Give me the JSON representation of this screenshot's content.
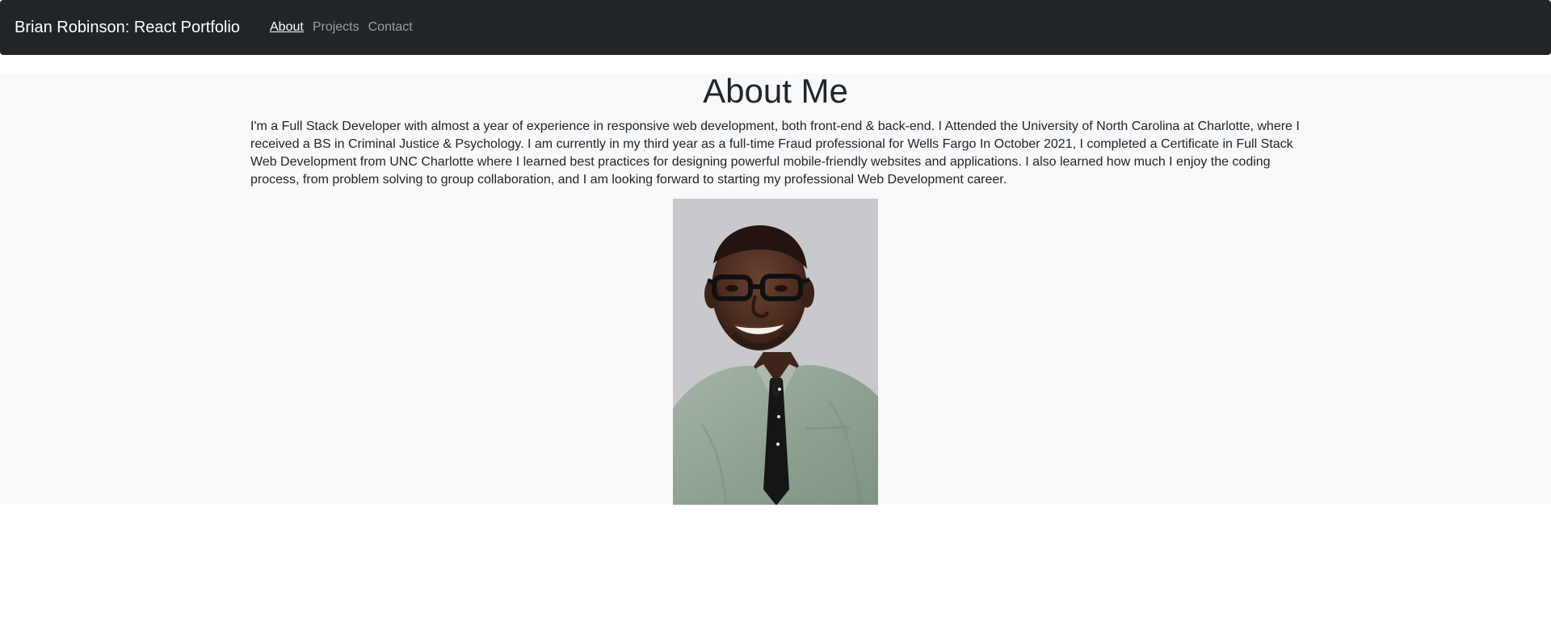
{
  "site": {
    "brand": "Brian Robinson: React Portfolio"
  },
  "nav": {
    "items": [
      {
        "label": "About",
        "active": true
      },
      {
        "label": "Projects",
        "active": false
      },
      {
        "label": "Contact",
        "active": false
      }
    ]
  },
  "about": {
    "title": "About Me",
    "bio": "I'm a Full Stack Developer with almost a year of experience in responsive web development, both front-end & back-end. I Attended the University of North Carolina at Charlotte, where I received a BS in Criminal Justice & Psychology. I am currently in my third year as a full-time Fraud professional for Wells Fargo In October 2021, I completed a Certificate in Full Stack Web Development from UNC Charlotte where I learned best practices for designing powerful mobile-friendly websites and applications. I also learned how much I enjoy the coding process, from problem solving to group collaboration, and I am looking forward to starting my professional Web Development career."
  },
  "colors": {
    "navbar": "#212529",
    "section_background": "#f8f9fa",
    "text": "#212529"
  }
}
